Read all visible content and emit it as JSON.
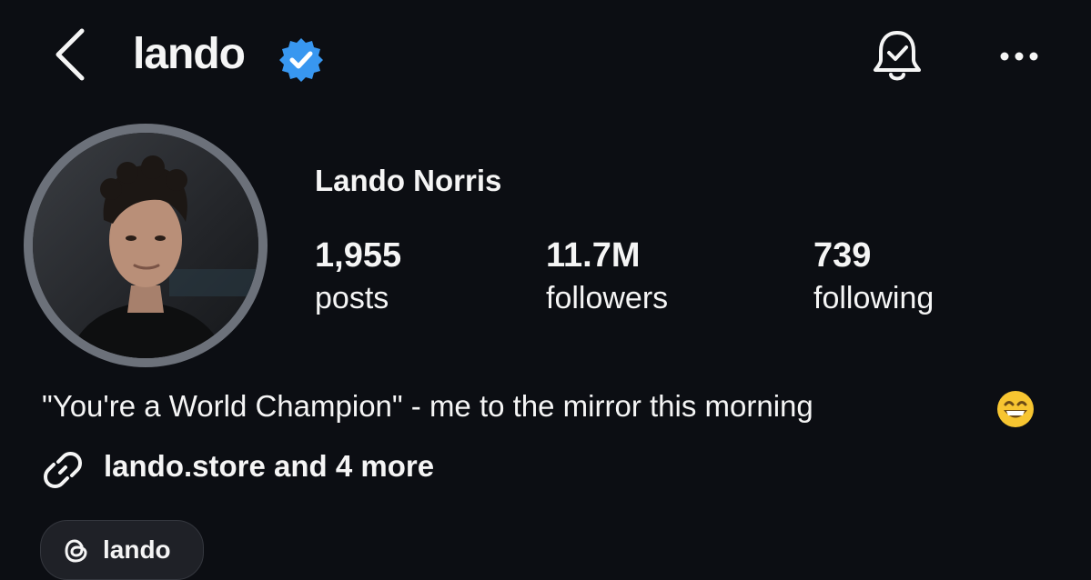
{
  "header": {
    "username": "lando",
    "icons": [
      "chevron-left-icon",
      "verified-badge-icon",
      "bell-check-icon",
      "more-horizontal-icon"
    ],
    "accent_color": "#3897f0"
  },
  "profile": {
    "display_name": "Lando Norris",
    "stats": [
      {
        "value": "1,955",
        "label": "posts"
      },
      {
        "value": "11.7M",
        "label": "followers"
      },
      {
        "value": "739",
        "label": "following"
      }
    ],
    "bio": "\"You're a World Champion\" - me to the mirror this morning",
    "bio_emoji": "grinning-face-icon",
    "link_text": "lando.store and 4 more",
    "threads_label": "lando"
  }
}
